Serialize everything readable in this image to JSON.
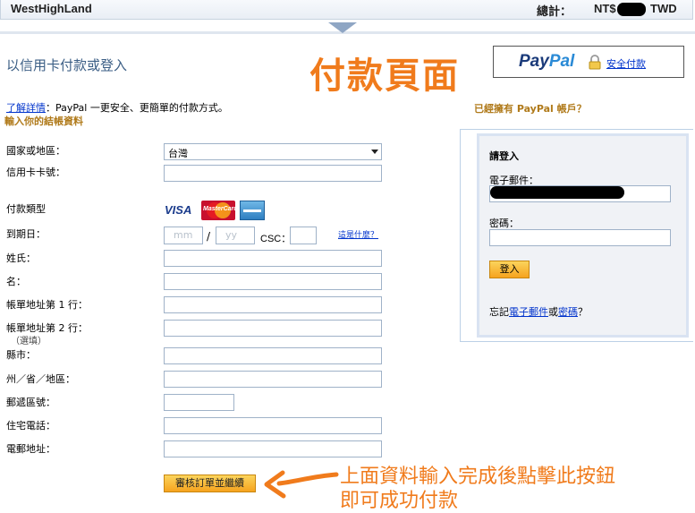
{
  "topbar": {
    "merchant": "WestHighLand",
    "total_label": "總計：",
    "total_prefix": "NT$",
    "currency": "TWD"
  },
  "main": {
    "heading": "以信用卡付款或登入",
    "big_title": "付款頁面",
    "paypal_pay": "Pay",
    "paypal_pal": "Pal",
    "secure_link": "安全付款",
    "learn_more_link": "了解詳情",
    "learn_more_text": "：PayPal 一更安全、更簡單的付款方式。",
    "billing_heading": "輸入你的結帳資料"
  },
  "form": {
    "country_label": "國家或地區：",
    "country_value": "台灣",
    "card_number_label": "信用卡卡號：",
    "payment_type_label": "付款類型",
    "card_visa": "VISA",
    "card_mastercard": "MasterCard",
    "expiry_label": "到期日：",
    "expiry_mm_placeholder": "mm",
    "expiry_slash": "/",
    "expiry_yy_placeholder": "yy",
    "csc_label": "CSC：",
    "what_is_link": "這是什麼？",
    "last_name_label": "姓氏：",
    "first_name_label": "名：",
    "address1_label": "帳單地址第 1 行：",
    "address2_label": "帳單地址第 2 行：",
    "address2_hint": "（選填）",
    "city_label": "縣市：",
    "state_label": "州／省／地區：",
    "postal_label": "郵遞區號：",
    "phone_label": "住宅電話：",
    "email_label": "電郵地址：",
    "review_button": "審核訂單並繼續"
  },
  "login": {
    "question": "已經擁有 PayPal 帳戶？",
    "heading": "請登入",
    "email_label": "電子郵件：",
    "password_label": "密碼：",
    "login_button": "登入",
    "forgot_prefix": "忘記",
    "forgot_email_link": "電子郵件",
    "forgot_or": "或",
    "forgot_password_link": "密碼",
    "forgot_suffix": "？"
  },
  "annotation": {
    "line1": "上面資料輸入完成後點擊此按鈕",
    "line2": "即可成功付款"
  },
  "colors": {
    "accent_orange": "#f07b1c",
    "link_blue": "#0033cc",
    "heading_blue": "#3b5e85",
    "section_gold": "#b07a1a"
  }
}
